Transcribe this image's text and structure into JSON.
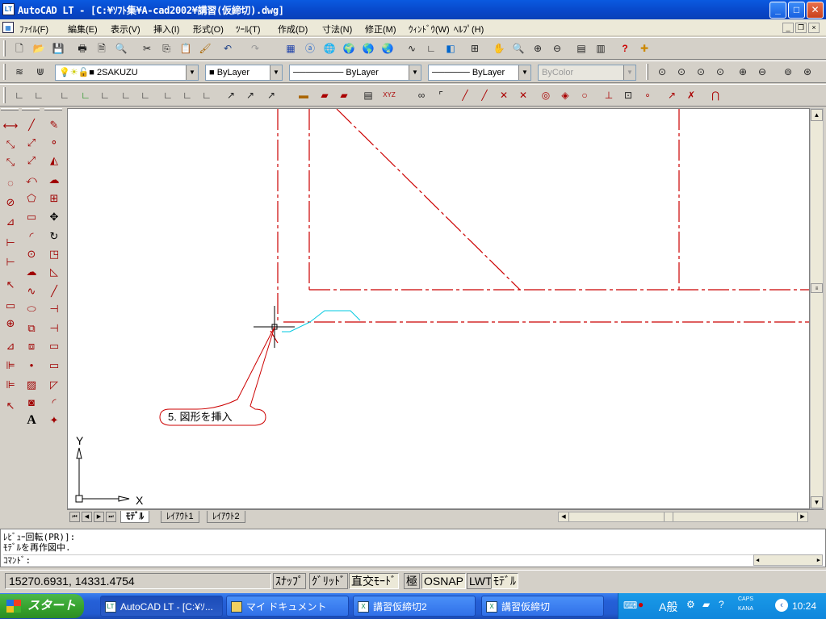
{
  "window": {
    "title": "AutoCAD LT - [C:¥ｿﾌﾄ集¥A-cad2002¥講習(仮締切).dwg]",
    "app_icon": "LT"
  },
  "menu": [
    "ﾌｧｲﾙ(F)",
    "編集(E)",
    "表示(V)",
    "挿入(I)",
    "形式(O)",
    "ﾂｰﾙ(T)",
    "作成(D)",
    "寸法(N)",
    "修正(M)",
    "ｳｨﾝﾄﾞｳ(W)",
    "ﾍﾙﾌﾟ(H)"
  ],
  "layer_toolbar": {
    "layer_name": "2SAKUZU",
    "color": "ByLayer",
    "linetype": "ByLayer",
    "lineweight": "ByLayer",
    "plotstyle": "ByColor"
  },
  "drawing": {
    "callout": "5. 図形を挿入",
    "ucs_x": "X",
    "ucs_y": "Y",
    "colors": {
      "line": "#cc0000",
      "insert": "#00c8e0",
      "callout": "#cc0000"
    }
  },
  "tabs": [
    "ﾓﾃﾞﾙ",
    "ﾚｲｱｳﾄ1",
    "ﾚｲｱｳﾄ2"
  ],
  "command": {
    "lines": [
      "ﾚﾋﾞｭｰ回転(PR)]:",
      "ﾓﾃﾞﾙを再作図中.",
      "ｺﾏﾝﾄﾞ:"
    ]
  },
  "status": {
    "coords": "15270.6931, 14331.4754",
    "toggles": [
      "ｽﾅｯﾌﾟ",
      "ｸﾞﾘｯﾄﾞ",
      "直交ﾓｰﾄﾞ",
      "極",
      "OSNAP",
      "LWT",
      "ﾓﾃﾞﾙ"
    ]
  },
  "taskbar": {
    "start": "スタート",
    "tasks": [
      "AutoCAD LT - [C:¥ｿ...",
      "マイ ドキュメント",
      "講習仮締切2",
      "講習仮締切"
    ],
    "tray_ime": "A般",
    "tray_caps": "CAPS",
    "tray_kana": "KANA",
    "clock": "10:24"
  }
}
